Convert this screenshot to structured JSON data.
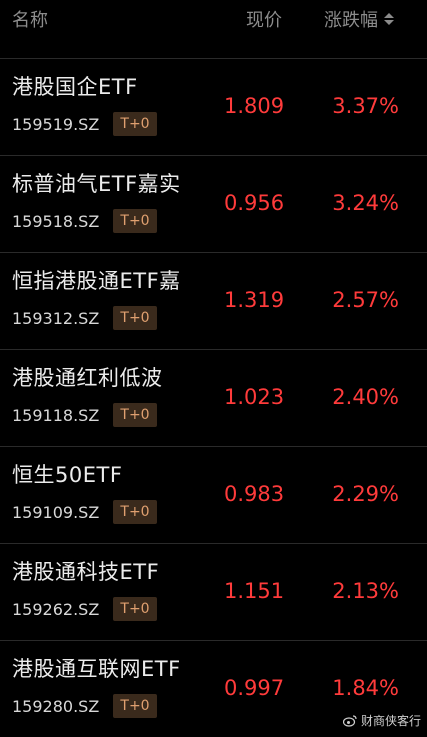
{
  "header": {
    "name": "名称",
    "price": "现价",
    "change": "涨跌幅"
  },
  "rows": [
    {
      "name": "港股国企ETF",
      "code": "159519.SZ",
      "badge": "T+0",
      "price": "1.809",
      "change": "3.37%"
    },
    {
      "name": "标普油气ETF嘉实",
      "code": "159518.SZ",
      "badge": "T+0",
      "price": "0.956",
      "change": "3.24%"
    },
    {
      "name": "恒指港股通ETF嘉",
      "code": "159312.SZ",
      "badge": "T+0",
      "price": "1.319",
      "change": "2.57%"
    },
    {
      "name": "港股通红利低波",
      "code": "159118.SZ",
      "badge": "T+0",
      "price": "1.023",
      "change": "2.40%"
    },
    {
      "name": "恒生50ETF",
      "code": "159109.SZ",
      "badge": "T+0",
      "price": "0.983",
      "change": "2.29%"
    },
    {
      "name": "港股通科技ETF",
      "code": "159262.SZ",
      "badge": "T+0",
      "price": "1.151",
      "change": "2.13%"
    },
    {
      "name": "港股通互联网ETF",
      "code": "159280.SZ",
      "badge": "T+0",
      "price": "0.997",
      "change": "1.84%"
    }
  ],
  "watermark": {
    "icon": "weibo-icon",
    "text": "财商侠客行"
  },
  "colors": {
    "up": "#ff3b3b",
    "background": "#000000",
    "badge_bg": "#3a2a1c",
    "badge_text": "#e0a070"
  }
}
